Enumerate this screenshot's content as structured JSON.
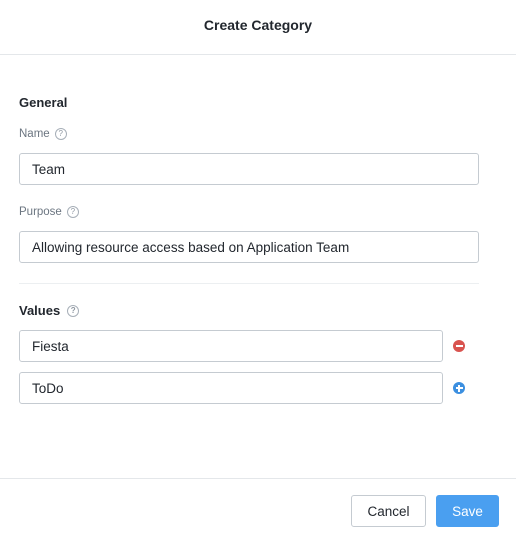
{
  "dialog": {
    "title": "Create Category"
  },
  "general": {
    "heading": "General",
    "name_label": "Name",
    "name_value": "Team",
    "purpose_label": "Purpose",
    "purpose_value": "Allowing resource access based on Application Team"
  },
  "values": {
    "heading": "Values",
    "items": [
      {
        "value": "Fiesta",
        "action": "remove"
      },
      {
        "value": "ToDo",
        "action": "add"
      }
    ]
  },
  "help_glyph": "?",
  "icons": {
    "help": "question-circle-icon",
    "remove": "minus-circle-icon",
    "add": "plus-circle-icon"
  },
  "colors": {
    "primary": "#4a9ff0",
    "danger": "#d9534f",
    "add": "#3b8fe0"
  },
  "footer": {
    "cancel_label": "Cancel",
    "save_label": "Save"
  }
}
